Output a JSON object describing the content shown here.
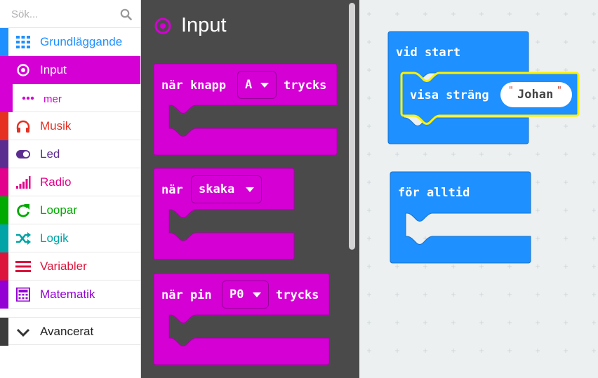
{
  "colors": {
    "grundlaggande": "#1e90ff",
    "input": "#d400d4",
    "musik": "#e63022",
    "led": "#5c2d91",
    "radio": "#e3008c",
    "loopar": "#00aa00",
    "logik": "#00a4a6",
    "variabler": "#dc143c",
    "matematik": "#9400d3",
    "avancerat": "#3c3c3c",
    "flyout_bg": "#4b4a4b",
    "basic_block": "#1e90ff",
    "input_block": "#d400d4",
    "highlight": "#fff200"
  },
  "search": {
    "placeholder": "Sök..."
  },
  "sidebar": {
    "categories": [
      {
        "label": "Grundläggande",
        "icon": "grid-icon"
      },
      {
        "label": "Input",
        "icon": "target-icon",
        "selected": true
      },
      {
        "label": "mer",
        "icon": "dots-icon"
      },
      {
        "label": "Musik",
        "icon": "headphones-icon"
      },
      {
        "label": "Led",
        "icon": "toggle-icon"
      },
      {
        "label": "Radio",
        "icon": "signal-bars-icon"
      },
      {
        "label": "Loopar",
        "icon": "refresh-icon"
      },
      {
        "label": "Logik",
        "icon": "shuffle-icon"
      },
      {
        "label": "Variabler",
        "icon": "list-lines-icon"
      },
      {
        "label": "Matematik",
        "icon": "calculator-icon"
      },
      {
        "label": "Avancerat",
        "icon": "chevron-down-icon"
      }
    ]
  },
  "flyout": {
    "title": "Input",
    "blocks": [
      {
        "prefix": "när knapp",
        "dropdown": "A",
        "suffix": "trycks"
      },
      {
        "prefix": "när",
        "dropdown": "skaka",
        "suffix": ""
      },
      {
        "prefix": "när pin",
        "dropdown": "P0",
        "suffix": "trycks"
      }
    ]
  },
  "workspace": {
    "on_start": {
      "label": "vid start"
    },
    "show_string": {
      "label": "visa sträng",
      "value": "Johan"
    },
    "forever": {
      "label": "för alltid"
    }
  },
  "glyphs": {
    "quote_open": "\"",
    "quote_close": "\""
  }
}
